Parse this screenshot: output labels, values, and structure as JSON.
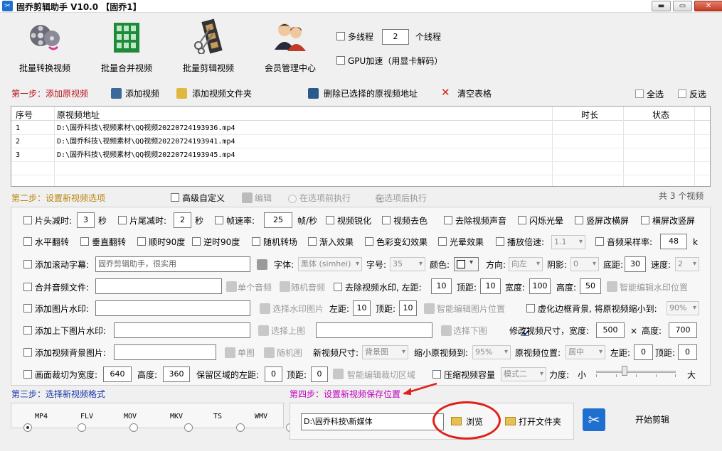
{
  "titlebar": {
    "icon": "scissors-icon",
    "title": "固乔剪辑助手 V10.0  【固乔1】",
    "min": "▬",
    "max": "▭",
    "close": "✕"
  },
  "toolbar": {
    "batch_convert": "批量转换视频",
    "batch_merge": "批量合并视频",
    "batch_cut": "批量剪辑视频",
    "member_center": "会员管理中心"
  },
  "threads": {
    "label": "多线程",
    "value": "2",
    "unit": "个线程",
    "gpu": "GPU加速（用显卡解码）"
  },
  "step1": {
    "title": "第一步：添加原视频",
    "add_video": "添加视频",
    "add_folder": "添加视频文件夹",
    "delete_selected": "删除已选择的原视频地址",
    "clear_table": "清空表格",
    "select_all": "全选",
    "invert": "反选"
  },
  "table": {
    "headers": [
      "序号",
      "原视频地址",
      "时长",
      "状态"
    ],
    "rows": [
      {
        "n": "1",
        "path": "D:\\固乔科技\\视频素材\\QQ视频20220724193936.mp4"
      },
      {
        "n": "2",
        "path": "D:\\固乔科技\\视频素材\\QQ视频20220724193941.mp4"
      },
      {
        "n": "3",
        "path": "D:\\固乔科技\\视频素材\\QQ视频20220724193945.mp4"
      }
    ]
  },
  "step2": {
    "title": "第二步：设置新视频选项",
    "advanced": "高级自定义",
    "edit": "编辑",
    "before": "在选项前执行",
    "after": "在选项后执行",
    "count": "共 3 个视频"
  },
  "opts": {
    "r1": {
      "head_cut": "片头减时:",
      "head_val": "3",
      "sec1": "秒",
      "tail_cut": "片尾减时:",
      "tail_val": "2",
      "sec2": "秒",
      "fps": "帧速率:",
      "fps_val": "25",
      "fps_unit": "帧/秒",
      "sharpen": "视频锐化",
      "decolor": "视频去色",
      "mute": "去除视频声音",
      "flash": "闪烁光晕",
      "v2h": "竖屏改横屏",
      "h2v": "横屏改竖屏"
    },
    "r2": {
      "hflip": "水平翻转",
      "vflip": "垂直翻转",
      "cw90": "顺时90度",
      "ccw90": "逆时90度",
      "random_trans": "随机转场",
      "fadein": "渐入效果",
      "color_fx": "色彩变幻效果",
      "glow": "光晕效果",
      "speed": "播放倍速:",
      "speed_val": "1.1",
      "sample_rate": "音频采样率:",
      "sample_val": "48",
      "sample_unit": "k"
    },
    "r3": {
      "scroll": "添加滚动字幕:",
      "scroll_text": "固乔剪辑助手，很实用",
      "font": "字体:",
      "font_val": "黑体 (simhei)",
      "size": "字号:",
      "size_val": "35",
      "color": "颜色:",
      "dir": "方向:",
      "dir_val": "向左",
      "shadow": "阴影:",
      "shadow_val": "0",
      "bottom": "底距:",
      "bottom_val": "30",
      "velocity": "速度:",
      "velocity_val": "2"
    },
    "r4": {
      "merge_audio": "合并音频文件:",
      "single_audio": "单个音频",
      "random_audio": "随机音频",
      "remove_wm": "去除视频水印, 左距:",
      "wm_left": "10",
      "top": "顶距:",
      "wm_top": "10",
      "width": "宽度:",
      "wm_w": "100",
      "height": "高度:",
      "wm_h": "50",
      "smart_wm": "智能编辑水印位置"
    },
    "r5": {
      "img_wm": "添加图片水印:",
      "choose_img": "选择水印图片",
      "left": "左距:",
      "left_val": "10",
      "top": "顶距:",
      "top_val": "10",
      "smart_img": "智能编辑图片位置",
      "blur_bg": "虚化边框背景, 将原视频缩小到:",
      "blur_val": "90%"
    },
    "r6": {
      "tb_img": "添加上下图片水印:",
      "choose_top": "选择上图",
      "choose_bottom": "选择下图",
      "resize": "修改视频尺寸，宽度:",
      "w_val": "500",
      "x": "×",
      "h": "高度:",
      "h_val": "700"
    },
    "r7": {
      "bg_img": "添加视频背景图片:",
      "single": "单图",
      "random": "随机图",
      "new_size": "新视频尺寸:",
      "new_size_val": "背景图",
      "shrink": "缩小原视频到:",
      "shrink_val": "95%",
      "pos": "原视频位置:",
      "pos_val": "居中",
      "left": "左距:",
      "left_val": "0",
      "top": "顶距:",
      "top_val": "0"
    },
    "r8": {
      "crop": "画面裁切为宽度:",
      "crop_w": "640",
      "h": "高度:",
      "crop_h": "360",
      "keep_left": "保留区域的左距:",
      "keep_left_val": "0",
      "top": "顶距:",
      "top_val": "0",
      "smart_crop": "智能编辑裁切区域",
      "compress": "压缩视频容量",
      "mode": "模式二",
      "strength": "力度:",
      "small": "小",
      "big": "大",
      "strength_level": 0.35
    }
  },
  "step3": {
    "title": "第三步：选择新视频格式",
    "formats": [
      "MP4",
      "FLV",
      "MOV",
      "MKV",
      "TS",
      "WMV"
    ],
    "selected": "MP4"
  },
  "step4": {
    "title": "第四步：设置新视频保存位置",
    "path": "D:\\固乔科技\\新媒体",
    "browse": "浏览",
    "open_folder": "打开文件夹",
    "start": "开始剪辑"
  },
  "colors": {
    "accent_red": "#b5121b",
    "step2_blue": "#1a34a8",
    "step4_magenta": "#c000c0",
    "annotation": "#e0201a"
  }
}
